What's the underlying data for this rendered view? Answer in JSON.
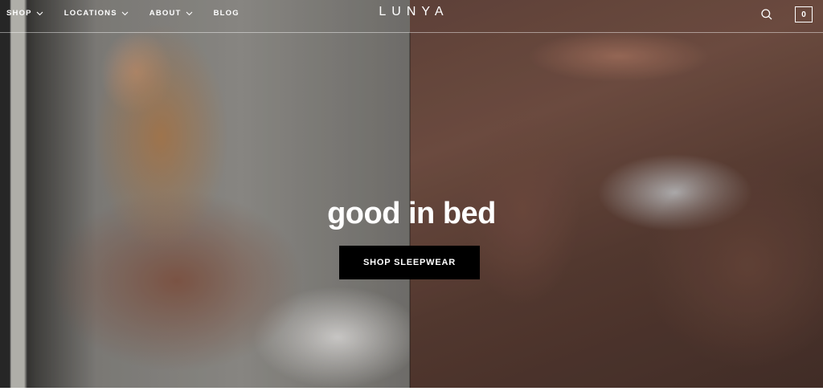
{
  "nav": {
    "items": [
      {
        "label": "SHOP",
        "dropdown": true,
        "icon": "chevron-down-icon"
      },
      {
        "label": "LOCATIONS",
        "dropdown": true,
        "icon": "chevron-down-icon"
      },
      {
        "label": "ABOUT",
        "dropdown": true,
        "icon": "chevron-down-icon"
      },
      {
        "label": "BLOG",
        "dropdown": false
      }
    ]
  },
  "brand": {
    "logo": "LUNYA"
  },
  "header_actions": {
    "search_icon": "search-icon",
    "cart_count": "0"
  },
  "hero": {
    "headline": "good in bed",
    "cta_label": "SHOP SLEEPWEAR",
    "images": [
      "woman-in-pajamas-seated",
      "person-lounging-in-pajamas"
    ]
  },
  "colors": {
    "text": "#ffffff",
    "cta_background": "#000000",
    "pajama_tone": "#7a5548"
  }
}
